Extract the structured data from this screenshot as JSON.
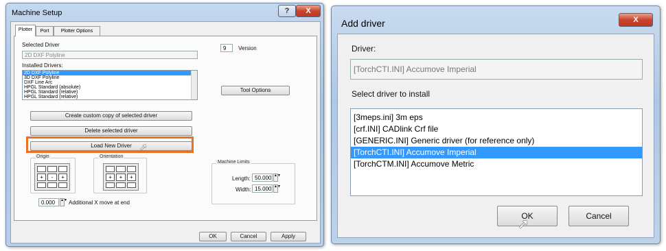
{
  "machine_setup": {
    "title": "Machine Setup",
    "help_glyph": "?",
    "close_glyph": "X",
    "tabs": [
      "Plotter",
      "Port",
      "Plotter Options"
    ],
    "selected_driver_label": "Selected Driver",
    "selected_driver_value": "2D DXF Polyline",
    "installed_drivers_label": "Installed Drivers:",
    "installed_drivers": [
      "2D DXF Polyline",
      "3D DXF Polyline",
      "DXF Line Arc",
      "HPGL Standard (absolute)",
      "HPGL Standard (relative)",
      "HPGL Standard (relative)"
    ],
    "version_value": "9",
    "version_label": "Version",
    "tool_options_label": "Tool Options",
    "create_custom_label": "Create custom copy of selected driver",
    "delete_driver_label": "Delete selected driver",
    "load_new_driver_label": "Load New Driver",
    "origin_label": "Origin",
    "orientation_label": "Orientation",
    "grid_a": [
      "",
      "",
      "",
      "+",
      "-",
      "+",
      "",
      "",
      ""
    ],
    "grid_b": [
      "",
      "",
      "",
      "+",
      "+",
      "+",
      "",
      "",
      ""
    ],
    "machine_limits_label": "Machine Limits",
    "length_label": "Length:",
    "length_value": "50.000",
    "width_label": "Width:",
    "width_value": "15.000",
    "x_move_value": "0.000",
    "x_move_label": "Additional X move at end",
    "ok_label": "OK",
    "cancel_label": "Cancel",
    "apply_label": "Apply"
  },
  "add_driver": {
    "title": "Add driver",
    "close_glyph": "X",
    "driver_label": "Driver:",
    "driver_value": "[TorchCTI.INI] Accumove Imperial",
    "select_label": "Select driver to install",
    "drivers": [
      "[3meps.ini] 3m eps",
      "[crf.INI] CADlink Crf file",
      "[GENERIC.INI] Generic driver (for reference only)",
      "[TorchCTI.INI] Accumove Imperial",
      "[TorchCTM.INI] Accumove Metric"
    ],
    "selected_index": 3,
    "ok_label": "OK",
    "cancel_label": "Cancel"
  },
  "colors": {
    "highlight": "#3399ff",
    "callout": "#ec7122",
    "title_gradient": "#b9cfe9"
  }
}
